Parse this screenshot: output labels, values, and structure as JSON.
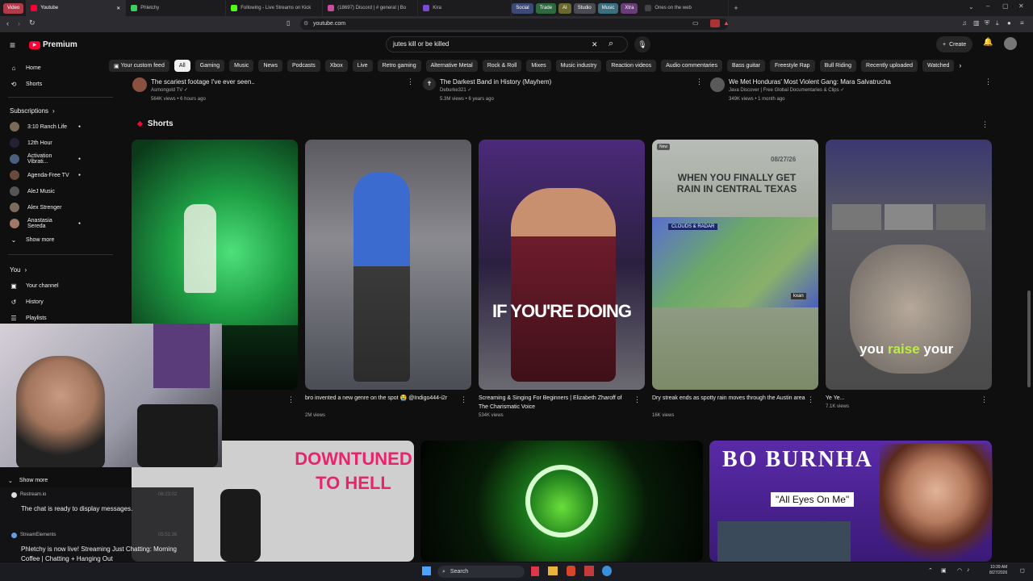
{
  "browser": {
    "groups": [
      "Video",
      "Social",
      "Trade",
      "AI",
      "Studio",
      "Music",
      "Xtra"
    ],
    "tabs": [
      {
        "label": "Youtube",
        "active": true
      },
      {
        "label": "Phletchy",
        "active": false
      },
      {
        "label": "Following - Live Streams on Kick",
        "active": false
      },
      {
        "label": "(18697) Discord | # general | Bo",
        "active": false
      },
      {
        "label": "Kira",
        "active": false
      },
      {
        "label": "Ones on the web",
        "active": false
      }
    ],
    "url": "youtube.com"
  },
  "youtube": {
    "logo_label": "Premium",
    "search_value": "jutes kill or be killed",
    "create_label": "Create",
    "chips": [
      "Your custom feed",
      "All",
      "Gaming",
      "Music",
      "News",
      "Podcasts",
      "Xbox",
      "Live",
      "Retro gaming",
      "Alternative Metal",
      "Rock & Roll",
      "Mixes",
      "Music industry",
      "Reaction videos",
      "Audio commentaries",
      "Bass guitar",
      "Freestyle Rap",
      "Bull Riding",
      "Recently uploaded",
      "Watched"
    ]
  },
  "sidebar": {
    "home": "Home",
    "shorts": "Shorts",
    "subscriptions_heading": "Subscriptions",
    "subscriptions": [
      "3:10 Ranch Life",
      "12th Hour",
      "Activation Vibrati...",
      "Agenda-Free TV",
      "AleJ Music",
      "Alex Strenger",
      "Anastasia Sereda"
    ],
    "show_more": "Show more",
    "you_heading": "You",
    "you_items": [
      "Your channel",
      "History",
      "Playlists"
    ],
    "show_more_2": "Show more"
  },
  "top_videos": [
    {
      "title": "The scariest footage I've ever seen..",
      "channel": "Asmongold TV",
      "meta": "564K views • 6 hours ago"
    },
    {
      "title": "The Darkest Band in History (Mayhem)",
      "channel": "Deburke321",
      "meta": "5.3M views • 6 years ago"
    },
    {
      "title": "We Met Honduras' Most Violent Gang: Mara Salvatrucha",
      "channel": "Java Discover | Free Global Documentaries & Clips",
      "meta": "349K views • 1 month ago"
    }
  ],
  "shorts": {
    "heading": "Shorts",
    "items": [
      {
        "title": "",
        "views": "",
        "overlay": ""
      },
      {
        "title": "bro invented a new genre on the spot 😭 @Indigo444-i2r",
        "views": "2M views",
        "overlay": ""
      },
      {
        "title": "Screaming & Singing For Beginners | Elizabeth Zharoff of The Charismatic Voice",
        "views": "534K views",
        "overlay": "IF YOU'RE DOING"
      },
      {
        "title": "Dry streak ends as spotty rain moves through the Austin area",
        "views": "16K views",
        "overlay": "WHEN YOU FINALLY GET RAIN IN CENTRAL TEXAS",
        "badge": "New",
        "date": "08/27/26",
        "weather_label": "CLOUDS & RADAR",
        "station": "kxan"
      },
      {
        "title": "Ye Ye...",
        "views": "7.1K views",
        "overlay": "you raise your",
        "highlight": "raise"
      }
    ]
  },
  "bottom_thumbs": [
    {
      "text": "DOWNTUNED TO HELL"
    },
    {
      "text": ""
    },
    {
      "text": "BO BURNHA",
      "sub": "\"All Eyes On Me\""
    }
  ],
  "chat": {
    "messages": [
      {
        "source": "Restream.io",
        "time": "06:23:02",
        "text": "The chat is ready to display messages."
      },
      {
        "source": "StreamElements",
        "time": "05:51:36",
        "text": "Phletchy is now live! Streaming Just Chatting: Morning Coffee | Chatting + Hanging Out"
      }
    ]
  },
  "taskbar": {
    "search_label": "Search",
    "time": "10:39 AM",
    "date": "8/27/2026"
  },
  "colors": {
    "bg": "#0f0f0f",
    "chip_bg": "#272727",
    "yt_red": "#ff0033",
    "tab_bg": "#1c1c1f"
  }
}
